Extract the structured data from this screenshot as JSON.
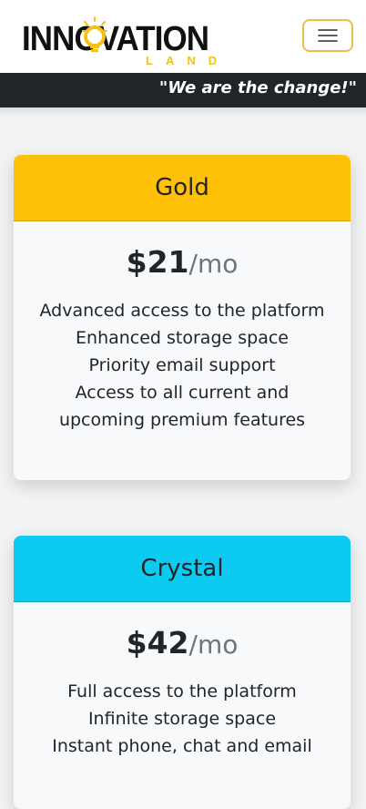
{
  "brand": {
    "logo_main": "INNOVATION",
    "logo_sub": "LAND",
    "tagline": "\"We are the change!\""
  },
  "colors": {
    "gold": "#ffc107",
    "crystal": "#0dcaf0",
    "toggle_border": "#e9c04a",
    "tagline_bg": "#212529"
  },
  "icons": {
    "menu_toggle": "hamburger-icon",
    "logo_bulb": "lightbulb-icon"
  },
  "plans": [
    {
      "name": "Gold",
      "price": "$21",
      "period": "/mo",
      "features": [
        "Advanced access to the platform",
        "Enhanced storage space",
        "Priority email support",
        "Access to all current and upcoming premium features"
      ]
    },
    {
      "name": "Crystal",
      "price": "$42",
      "period": "/mo",
      "features": [
        "Full access to the platform",
        "Infinite storage space",
        "Instant phone, chat and email"
      ]
    }
  ]
}
